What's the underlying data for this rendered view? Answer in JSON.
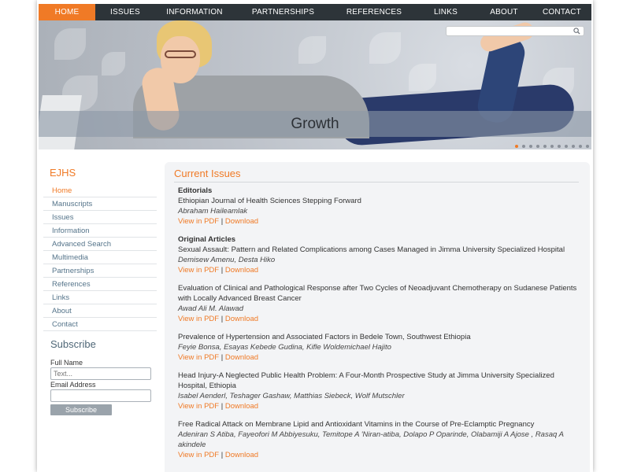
{
  "nav": {
    "items": [
      {
        "label": "HOME",
        "active": true
      },
      {
        "label": "ISSUES"
      },
      {
        "label": "INFORMATION"
      },
      {
        "label": "PARTNERSHIPS"
      },
      {
        "label": "REFERENCES"
      },
      {
        "label": "LINKS"
      },
      {
        "label": "ABOUT"
      },
      {
        "label": "CONTACT"
      }
    ]
  },
  "banner": {
    "caption": "Growth",
    "search_placeholder": "",
    "slide_count": 11,
    "active_slide": 1
  },
  "sidebar": {
    "title": "EJHS",
    "menu": [
      "Home",
      "Manuscripts",
      "Issues",
      "Information",
      "Advanced Search",
      "Multimedia",
      "Partnerships",
      "References",
      "Links",
      "About",
      "Contact"
    ],
    "active_item": "Home"
  },
  "subscribe": {
    "title": "Subscribe",
    "full_name_label": "Full Name",
    "full_name_placeholder": "Text...",
    "email_label": "Email Address",
    "email_value": "",
    "button_label": "Subscribe"
  },
  "main": {
    "title": "Current Issues",
    "sections": [
      {
        "heading": "Editorials",
        "articles": [
          {
            "title": "Ethiopian Journal of Health Sciences Stepping Forward",
            "authors": "Abraham Haileamlak",
            "pdf": "View in PDF",
            "sep": "|",
            "download": "Download"
          }
        ]
      },
      {
        "heading": "Original Articles",
        "articles": [
          {
            "title": "Sexual Assault: Pattern and Related Complications among Cases Managed in Jimma University Specialized Hospital",
            "authors": "Demisew Amenu, Desta Hiko",
            "pdf": "View in PDF",
            "sep": "|",
            "download": "Download"
          },
          {
            "title": "Evaluation of Clinical and Pathological Response after Two Cycles of Neoadjuvant Chemotherapy on Sudanese Patients with Locally Advanced Breast Cancer",
            "authors": "Awad Ali M. Alawad",
            "pdf": "View in PDF",
            "sep": "|",
            "download": "Download"
          },
          {
            "title": "Prevalence of Hypertension and Associated Factors in Bedele Town, Southwest Ethiopia",
            "authors": "Feyie Bonsa, Esayas Kebede Gudina, Kifle Woldemichael Hajito",
            "pdf": "View in PDF",
            "sep": "|",
            "download": "Download"
          },
          {
            "title": "Head Injury-A Neglected Public Health Problem: A Four-Month Prospective Study at Jimma University Specialized Hospital, Ethiopia",
            "authors": "Isabel Aenderl, Teshager Gashaw, Matthias Siebeck, Wolf Mutschler",
            "pdf": "View in PDF",
            "sep": "|",
            "download": "Download"
          },
          {
            "title": "Free Radical Attack on Membrane Lipid and Antioxidant Vitamins in the Course of Pre-Eclamptic Pregnancy",
            "authors": "Adeniran S Atiba, Fayeofori M Abbiyesuku, Temitope A 'Niran-atiba, Dolapo P Oparinde, Olabamiji A Ajose , Rasaq A akindele",
            "pdf": "View in PDF",
            "sep": "|",
            "download": "Download"
          }
        ]
      }
    ]
  }
}
